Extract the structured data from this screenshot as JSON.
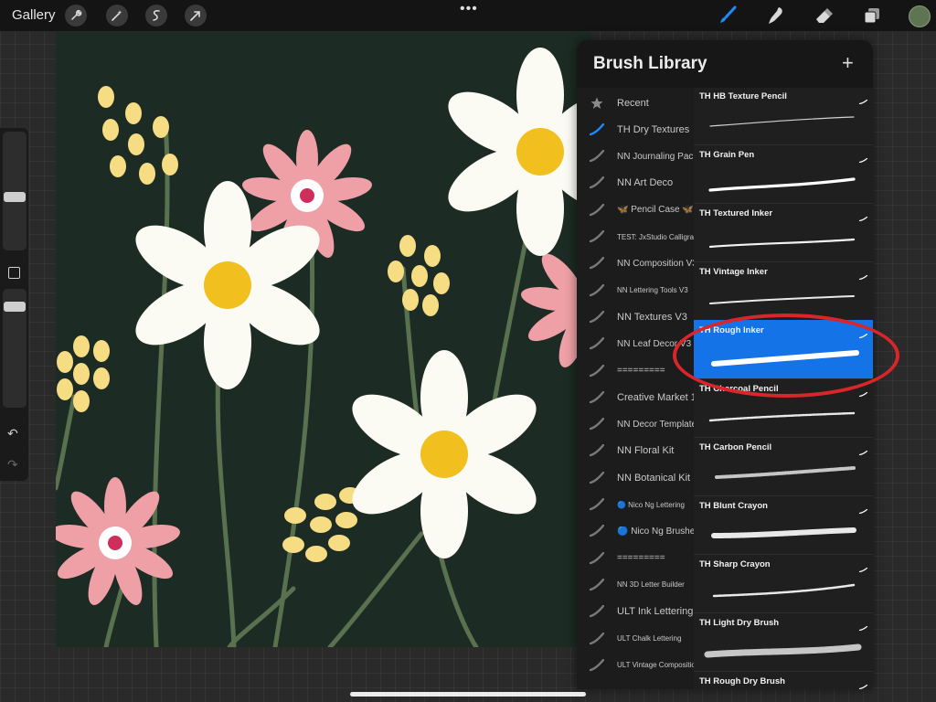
{
  "topbar": {
    "gallery_label": "Gallery",
    "tools_left": [
      "wrench-icon",
      "magic-wand-icon",
      "selection-icon",
      "transform-arrow-icon"
    ],
    "more_label": "•••",
    "tools_right": [
      "brush-icon",
      "smudge-icon",
      "eraser-icon",
      "layers-icon"
    ],
    "current_color": "#5f7552"
  },
  "brush_library": {
    "title": "Brush Library",
    "add_label": "+",
    "selected_set": "TH Dry Textures",
    "sets": [
      {
        "label": "Recent",
        "icon": "star-icon"
      },
      {
        "label": "TH Dry Textures",
        "icon": "brush-stroke-icon"
      },
      {
        "label": "NN Journaling Pack",
        "icon": "brush-stroke-icon"
      },
      {
        "label": "NN Art Deco",
        "icon": "brush-stroke-icon"
      },
      {
        "label": "🦋 Pencil Case 🦋",
        "icon": "brush-stroke-icon"
      },
      {
        "label": "TEST: JxStudio Calligraphy",
        "icon": "brush-stroke-icon"
      },
      {
        "label": "NN Composition V3",
        "icon": "brush-stroke-icon"
      },
      {
        "label": "NN Lettering Tools V3",
        "icon": "brush-stroke-icon"
      },
      {
        "label": "NN Textures V3",
        "icon": "brush-stroke-icon"
      },
      {
        "label": "NN Leaf Decor V3",
        "icon": "brush-stroke-icon"
      },
      {
        "label": "=========",
        "icon": "brush-stroke-icon"
      },
      {
        "label": "Creative Market 1",
        "icon": "brush-stroke-icon"
      },
      {
        "label": "NN Decor Templates",
        "icon": "brush-stroke-icon"
      },
      {
        "label": "NN Floral Kit",
        "icon": "brush-stroke-icon"
      },
      {
        "label": "NN Botanical Kit",
        "icon": "brush-stroke-icon"
      },
      {
        "label": "🔵 Nico Ng Lettering",
        "icon": "brush-stroke-icon"
      },
      {
        "label": "🔵 Nico Ng Brushes",
        "icon": "brush-stroke-icon"
      },
      {
        "label": "=========",
        "icon": "brush-stroke-icon"
      },
      {
        "label": "NN 3D Letter Builder",
        "icon": "brush-stroke-icon"
      },
      {
        "label": "ULT Ink Lettering",
        "icon": "brush-stroke-icon"
      },
      {
        "label": "ULT Chalk Lettering",
        "icon": "brush-stroke-icon"
      },
      {
        "label": "ULT Vintage Composition",
        "icon": "brush-stroke-icon"
      }
    ],
    "brushes": [
      {
        "name": "TH HB Texture Pencil",
        "selected": false
      },
      {
        "name": "TH Grain Pen",
        "selected": false
      },
      {
        "name": "TH Textured Inker",
        "selected": false
      },
      {
        "name": "TH Vintage Inker",
        "selected": false
      },
      {
        "name": "TH Rough Inker",
        "selected": true
      },
      {
        "name": "TH Charcoal Pencil",
        "selected": false
      },
      {
        "name": "TH Carbon Pencil",
        "selected": false
      },
      {
        "name": "TH Blunt Crayon",
        "selected": false
      },
      {
        "name": "TH Sharp Crayon",
        "selected": false
      },
      {
        "name": "TH Light Dry Brush",
        "selected": false
      },
      {
        "name": "TH Rough Dry Brush",
        "selected": false
      }
    ]
  },
  "colors": {
    "selection_blue": "#1473e6",
    "annotation_red": "#d9262b",
    "canvas_bg": "#1c2b23"
  }
}
